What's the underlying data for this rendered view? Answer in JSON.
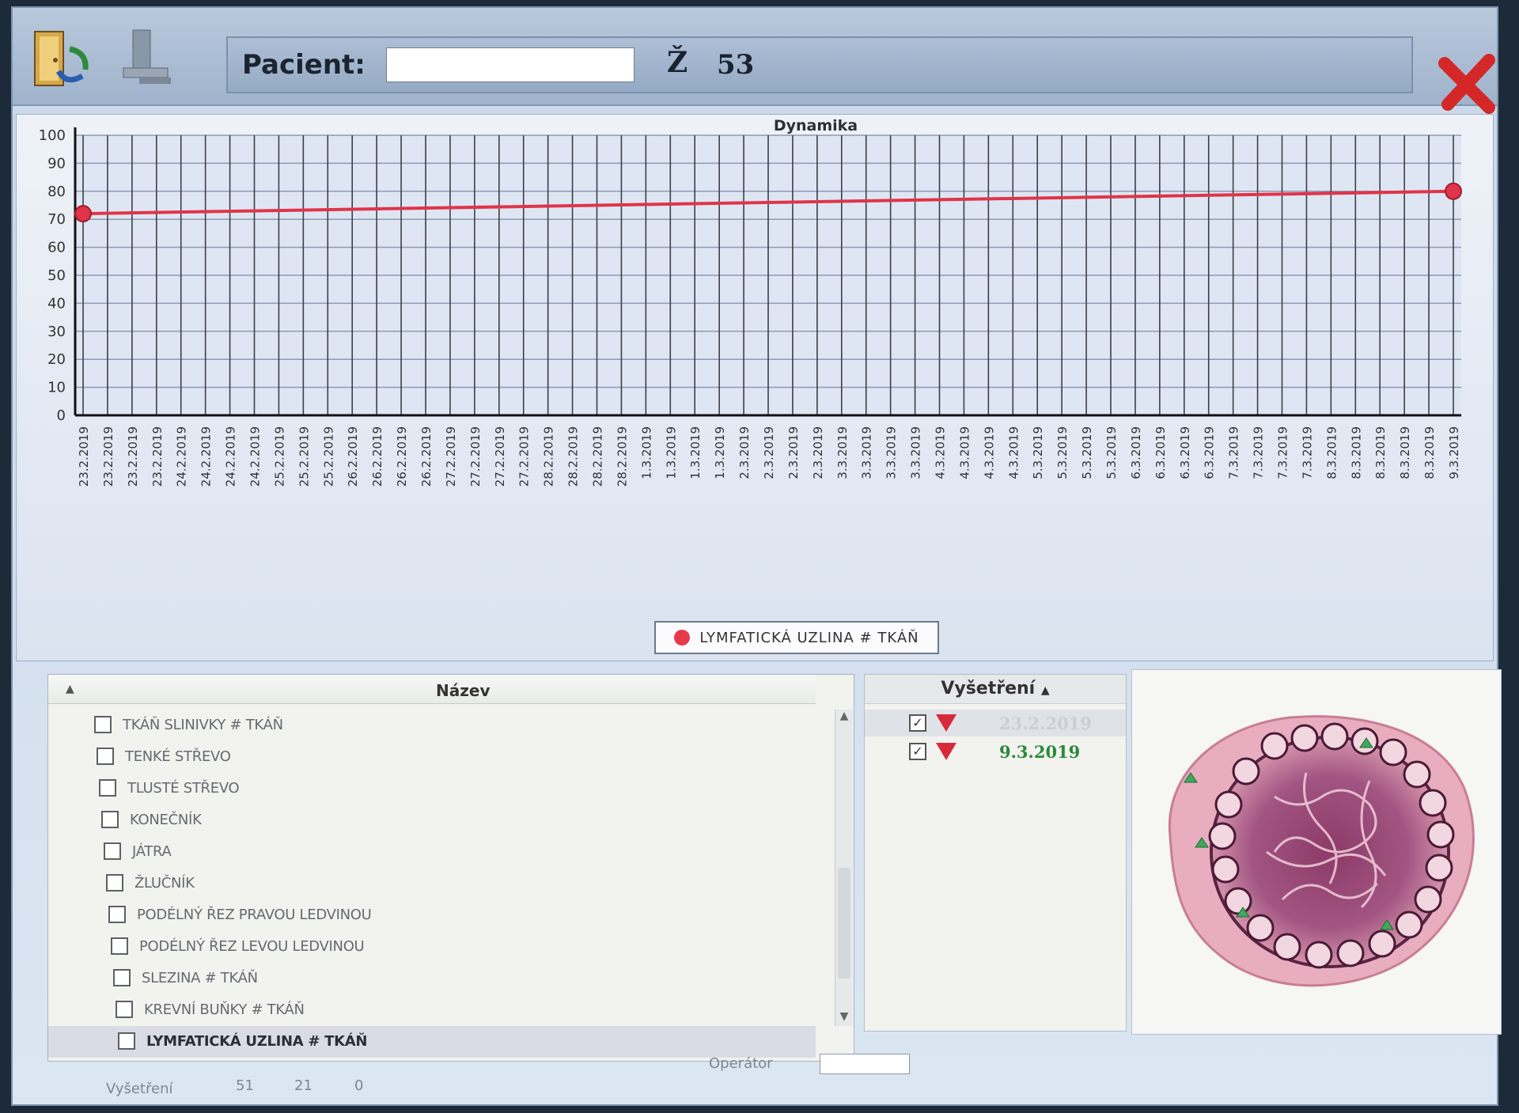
{
  "header": {
    "patient_label": "Pacient:",
    "sex": "Ž",
    "age": "53"
  },
  "icons": {
    "exit": "door-exit-icon",
    "computer": "computer-icon",
    "close": "close-icon"
  },
  "chart_data": {
    "type": "line",
    "title": "Dynamika",
    "xlabel": "",
    "ylabel": "",
    "ylim": [
      0,
      100
    ],
    "yticks": [
      0,
      10,
      20,
      30,
      40,
      50,
      60,
      70,
      80,
      90,
      100
    ],
    "grid": true,
    "legend_placement": "bottom-center",
    "categories": [
      "23.2.2019",
      "23.2.2019",
      "23.2.2019",
      "23.2.2019",
      "24.2.2019",
      "24.2.2019",
      "24.2.2019",
      "24.2.2019",
      "25.2.2019",
      "25.2.2019",
      "25.2.2019",
      "26.2.2019",
      "26.2.2019",
      "26.2.2019",
      "26.2.2019",
      "27.2.2019",
      "27.2.2019",
      "27.2.2019",
      "27.2.2019",
      "28.2.2019",
      "28.2.2019",
      "28.2.2019",
      "28.2.2019",
      "1.3.2019",
      "1.3.2019",
      "1.3.2019",
      "1.3.2019",
      "2.3.2019",
      "2.3.2019",
      "2.3.2019",
      "2.3.2019",
      "3.3.2019",
      "3.3.2019",
      "3.3.2019",
      "3.3.2019",
      "4.3.2019",
      "4.3.2019",
      "4.3.2019",
      "4.3.2019",
      "5.3.2019",
      "5.3.2019",
      "5.3.2019",
      "5.3.2019",
      "6.3.2019",
      "6.3.2019",
      "6.3.2019",
      "6.3.2019",
      "7.3.2019",
      "7.3.2019",
      "7.3.2019",
      "7.3.2019",
      "8.3.2019",
      "8.3.2019",
      "8.3.2019",
      "8.3.2019",
      "8.3.2019",
      "9.3.2019"
    ],
    "series": [
      {
        "name": "LYMFATICKÁ UZLINA # TKÁŇ",
        "color": "#e0344a",
        "points": [
          {
            "x": "23.2.2019",
            "index": 0,
            "y": 72
          },
          {
            "x": "9.3.2019",
            "index": 56,
            "y": 80
          }
        ]
      }
    ]
  },
  "list": {
    "header": "Název",
    "items": [
      {
        "label": "Tkáň slinivky # tkáň",
        "checked": false,
        "selected": false
      },
      {
        "label": "Tenké střevo",
        "checked": false,
        "selected": false
      },
      {
        "label": "Tlusté střevo",
        "checked": false,
        "selected": false
      },
      {
        "label": "Konečník",
        "checked": false,
        "selected": false
      },
      {
        "label": "Játra",
        "checked": false,
        "selected": false
      },
      {
        "label": "Žlučník",
        "checked": false,
        "selected": false
      },
      {
        "label": "Podélný řez pravou ledvinou",
        "checked": false,
        "selected": false
      },
      {
        "label": "Podélný řez levou ledvinou",
        "checked": false,
        "selected": false
      },
      {
        "label": "Slezina # tkáň",
        "checked": false,
        "selected": false
      },
      {
        "label": "Krevní buňky # tkáň",
        "checked": false,
        "selected": false
      },
      {
        "label": "Lymfatická uzlina # tkáň",
        "checked": false,
        "selected": true
      }
    ]
  },
  "exams": {
    "header": "Vyšetření",
    "items": [
      {
        "date": "23.2.2019",
        "checked": true,
        "dim": true
      },
      {
        "date": "9.3.2019",
        "checked": true,
        "dim": false
      }
    ]
  },
  "footer": {
    "operator_label": "Operátor",
    "exam_label": "Vyšetření",
    "counts": [
      "51",
      "21",
      "0"
    ]
  }
}
